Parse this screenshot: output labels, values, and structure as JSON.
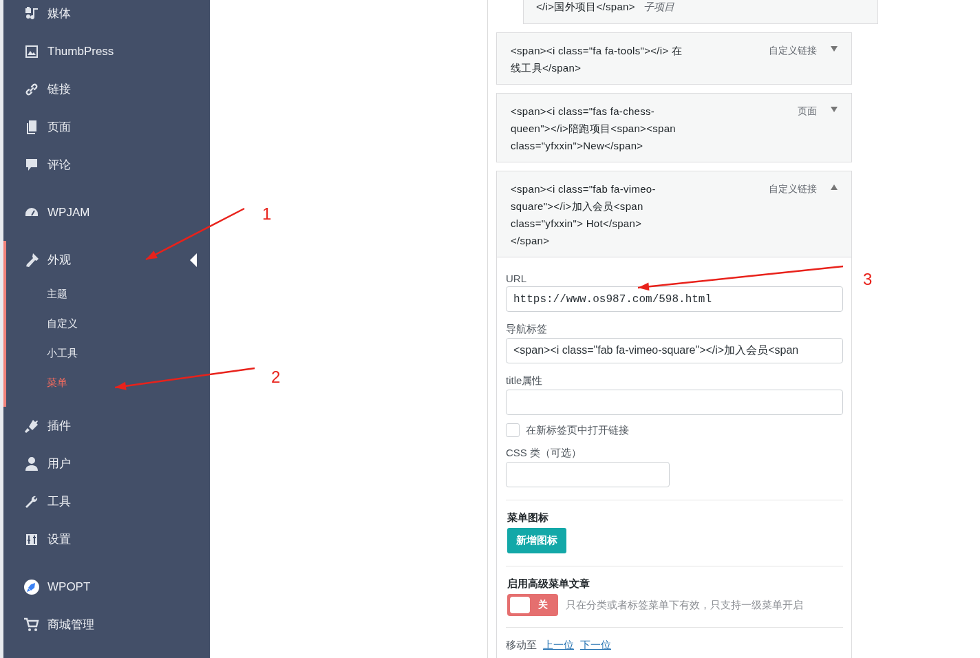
{
  "sidebar": {
    "groups": [
      {
        "items": [
          {
            "label": "媒体",
            "current": false
          },
          {
            "label": "ThumbPress",
            "current": false
          },
          {
            "label": "链接",
            "current": false
          },
          {
            "label": "页面",
            "current": false
          },
          {
            "label": "评论",
            "current": false
          }
        ]
      },
      {
        "items": [
          {
            "label": "WPJAM",
            "current": false
          }
        ]
      },
      {
        "items": [
          {
            "label": "外观",
            "current": true,
            "children": [
              {
                "label": "主题",
                "selected": false
              },
              {
                "label": "自定义",
                "selected": false
              },
              {
                "label": "小工具",
                "selected": false
              },
              {
                "label": "菜单",
                "selected": true
              }
            ]
          },
          {
            "label": "插件",
            "current": false
          },
          {
            "label": "用户",
            "current": false
          },
          {
            "label": "工具",
            "current": false
          },
          {
            "label": "设置",
            "current": false
          }
        ]
      },
      {
        "items": [
          {
            "label": "WPOPT",
            "current": false
          },
          {
            "label": "商城管理",
            "current": false
          }
        ]
      }
    ]
  },
  "menu_items": [
    {
      "title": "</i>国外项目</span>",
      "sub_label": "子项目",
      "expanded": false,
      "kind": "child"
    },
    {
      "title": "<span><i class=\"fa fa-tools\"></i> 在线工具</span>",
      "type": "自定义链接",
      "expanded": false,
      "kind": "top"
    },
    {
      "title": "<span><i class=\"fas fa-chess-queen\"></i>陪跑项目<span><span class=\"yfxxin\">New</span>",
      "type": "页面",
      "expanded": false,
      "kind": "top"
    },
    {
      "title": "<span><i class=\"fab fa-vimeo-square\"></i>加入会员<span class=\"yfxxin\"> Hot</span> </span>",
      "type": "自定义链接",
      "expanded": true,
      "kind": "top"
    }
  ],
  "settings": {
    "url": {
      "label": "URL",
      "value": "https://www.os987.com/598.html"
    },
    "nav_label": {
      "label": "导航标签",
      "value": "<span><i class=\"fab fa-vimeo-square\"></i>加入会员<span"
    },
    "title_attr": {
      "label": "title属性"
    },
    "new_tab": {
      "label": "在新标签页中打开链接",
      "checked": false
    },
    "css_class": {
      "label": "CSS 类（可选）"
    },
    "menu_icon": {
      "heading": "菜单图标",
      "button": "新增图标"
    },
    "advanced": {
      "heading": "启用高级菜单文章",
      "toggle": {
        "on": false,
        "label": "关"
      },
      "hint": "只在分类或者标签菜单下有效，只支持一级菜单开启"
    },
    "move": {
      "label": "移动至",
      "links": [
        "上一位",
        "下一位"
      ]
    }
  },
  "annotations": [
    {
      "number": "1"
    },
    {
      "number": "2"
    },
    {
      "number": "3"
    }
  ]
}
